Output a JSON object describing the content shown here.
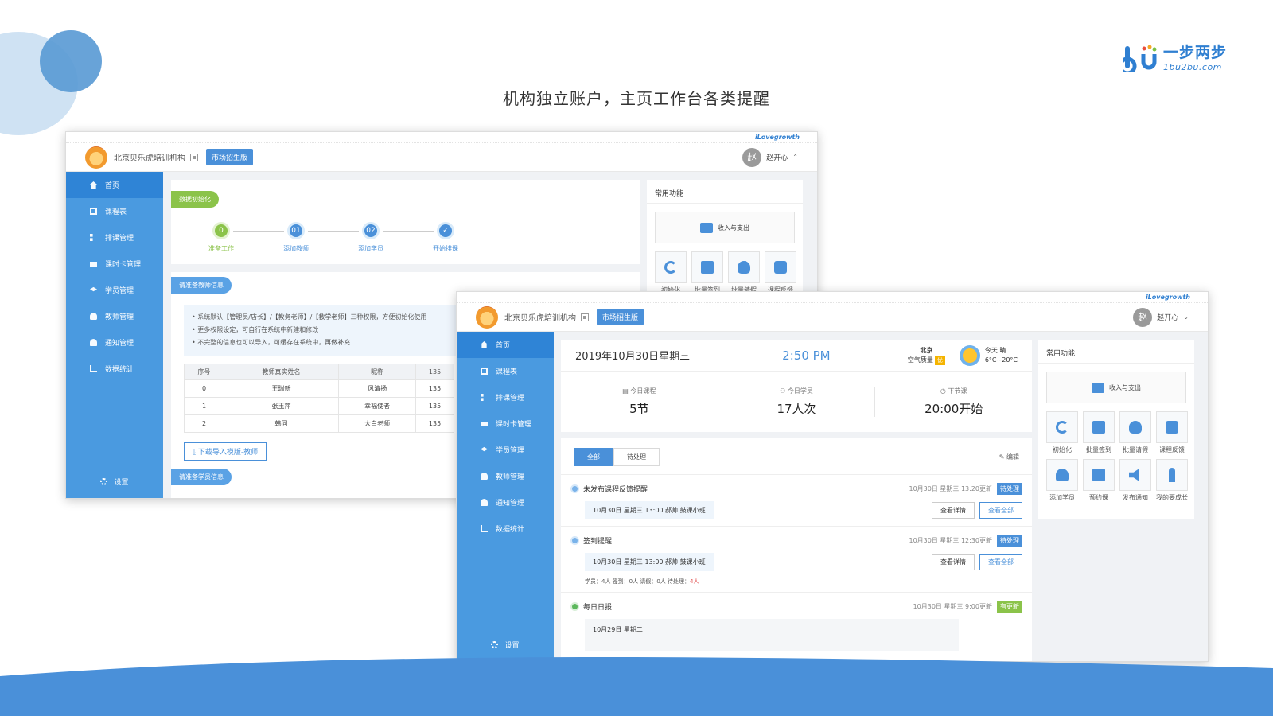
{
  "headline": "机构独立账户，主页工作台各类提醒",
  "brand": {
    "cn": "一步两步",
    "en": "1bu2bu.com"
  },
  "app": {
    "tagline": "iLovegrowth",
    "org_name": "北京贝乐虎培训机构",
    "edition_badge": "市场招生版",
    "user_avatar": "赵",
    "user_name": "赵开心"
  },
  "sidebar": {
    "items": [
      {
        "label": "首页",
        "icon": "home-icon"
      },
      {
        "label": "课程表",
        "icon": "calendar-icon"
      },
      {
        "label": "排课管理",
        "icon": "grid-icon"
      },
      {
        "label": "课时卡管理",
        "icon": "card-icon"
      },
      {
        "label": "学员管理",
        "icon": "graduation-cap-icon"
      },
      {
        "label": "教师管理",
        "icon": "person-icon"
      },
      {
        "label": "通知管理",
        "icon": "bell-icon"
      },
      {
        "label": "数据统计",
        "icon": "bar-chart-icon"
      }
    ],
    "settings": "设置"
  },
  "init_page": {
    "section_tag": "数据初始化",
    "steps": [
      {
        "num": "0",
        "label": "准备工作"
      },
      {
        "num": "01",
        "label": "添加教师"
      },
      {
        "num": "02",
        "label": "添加学员"
      },
      {
        "num": "✓",
        "label": "开始排课"
      }
    ],
    "teacher_section": "请准备教师信息",
    "tips": [
      "系统默认【管理员/店长】/【教务老师】/【教学老师】三种权限，方便初始化使用",
      "更多权限设定，可自行在系统中新建和修改",
      "不完整的信息也可以导入，可缓存在系统中，再做补充"
    ],
    "table": {
      "headers": [
        "序号",
        "教师真实姓名",
        "昵称",
        "135"
      ],
      "rows": [
        [
          "0",
          "王瑞新",
          "风清扬",
          "135"
        ],
        [
          "1",
          "张玉萍",
          "幸福使者",
          "135"
        ],
        [
          "2",
          "韩同",
          "大白老师",
          "135"
        ]
      ]
    },
    "download_button": "下载导入模版-教师",
    "student_section": "请准备学员信息"
  },
  "quick_panel": {
    "title": "常用功能",
    "income_button": "收入与支出",
    "row1": [
      {
        "label": "初始化",
        "icon": "refresh-icon"
      },
      {
        "label": "批量签到",
        "icon": "calendar-check-icon"
      },
      {
        "label": "批量请假",
        "icon": "people-icon"
      },
      {
        "label": "课程反馈",
        "icon": "chat-icon"
      }
    ],
    "row2": [
      {
        "label": "添加学员",
        "icon": "add-user-icon"
      },
      {
        "label": "预约课",
        "icon": "calendar-icon"
      },
      {
        "label": "发布通知",
        "icon": "speaker-icon"
      },
      {
        "label": "我的要成长",
        "icon": "growth-icon"
      }
    ]
  },
  "dashboard": {
    "date": "2019年10月30日星期三",
    "time": "2:50 PM",
    "city": "北京",
    "air_quality_label": "空气质量",
    "air_quality_value": "优",
    "weather_day": "今天",
    "weather_cond": "晴",
    "weather_temp": "6°C~20°C",
    "stats": [
      {
        "label": "今日课程",
        "value": "5节"
      },
      {
        "label": "今日学员",
        "value": "17人次"
      },
      {
        "label": "下节课",
        "value": "20:00开始"
      }
    ]
  },
  "todo": {
    "tabs": [
      "全部",
      "待处理"
    ],
    "edit": "编辑",
    "items": [
      {
        "title": "未发布课程反馈提醒",
        "updated": "10月30日 星期三 13:20更新",
        "badge": "待处理",
        "lesson": "10月30日 星期三 13:00   郝帅   鼓课小班",
        "detail_btn": "查看详情",
        "all_btn": "查看全部"
      },
      {
        "title": "签到提醒",
        "updated": "10月30日 星期三 12:30更新",
        "badge": "待处理",
        "lesson": "10月30日 星期三 13:00   郝帅   鼓课小班",
        "detail_btn": "查看详情",
        "all_btn": "查看全部",
        "counts_prefix": "学员：4人    签到：0人    请假：0人    待处理：",
        "counts_pending": "4人"
      },
      {
        "title": "每日日报",
        "updated": "10月30日 星期三 9:00更新",
        "badge": "有更新",
        "report_date": "10月29日 星期二"
      }
    ]
  },
  "colors": {
    "primary": "#4a90d9",
    "sidebar": "#4a9ae0",
    "green": "#8bc34a",
    "pending_red": "#e04b4b"
  }
}
